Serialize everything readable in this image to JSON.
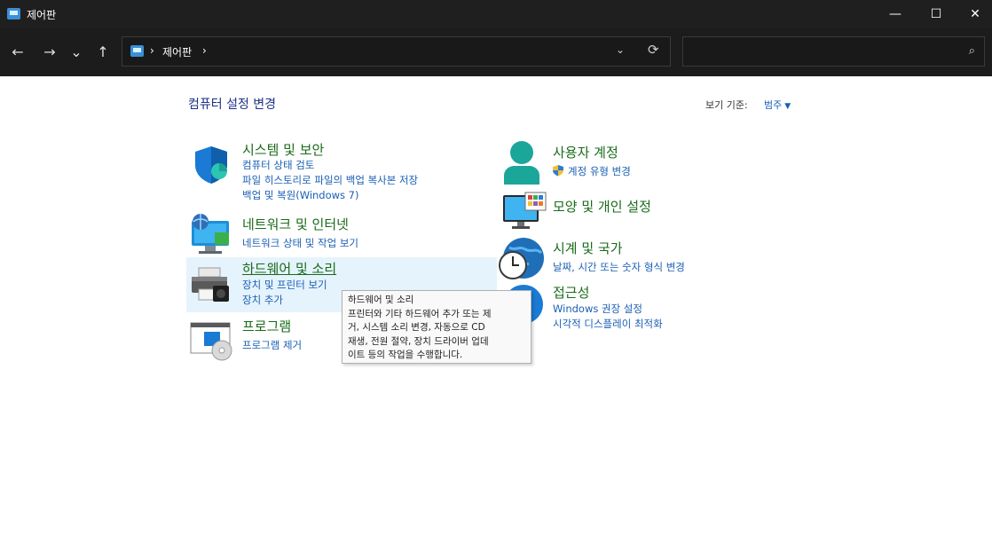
{
  "window": {
    "title": "제어판"
  },
  "titlebar": {
    "minimize": "—",
    "maximize": "☐",
    "close": "✕"
  },
  "nav": {
    "back": "←",
    "forward": "→",
    "recent": "⌄",
    "up": "↑"
  },
  "address": {
    "breadcrumb_sep1": "›",
    "location": "제어판",
    "breadcrumb_sep2": "›",
    "dropdown": "⌄",
    "refresh": "⟳"
  },
  "search": {
    "value": "",
    "icon": "⌕"
  },
  "content": {
    "heading": "컴퓨터 설정 변경",
    "view_by_label": "보기 기준:",
    "view_by_value": "범주",
    "view_by_caret": "▼"
  },
  "left_categories": [
    {
      "title": "시스템 및 보안",
      "icon": "shield-icon",
      "links": [
        "컴퓨터 상태 검토",
        "파일 히스토리로 파일의 백업 복사본 저장",
        "백업 및 복원(Windows 7)"
      ]
    },
    {
      "title": "네트워크 및 인터넷",
      "icon": "network-icon",
      "links": [
        "네트워크 상태 및 작업 보기"
      ]
    },
    {
      "title": "하드웨어 및 소리",
      "icon": "printer-icon",
      "links": [
        "장치 및 프린터 보기",
        "장치 추가"
      ]
    },
    {
      "title": "프로그램",
      "icon": "programs-icon",
      "links": [
        "프로그램 제거"
      ]
    }
  ],
  "right_categories": [
    {
      "title": "사용자 계정",
      "icon": "user-icon",
      "links": [
        "계정 유형 변경"
      ]
    },
    {
      "title": "모양 및 개인 설정",
      "icon": "monitor-icon",
      "links": []
    },
    {
      "title": "시계 및 국가",
      "icon": "clock-globe-icon",
      "links": [
        "날짜, 시간 또는 숫자 형식 변경"
      ]
    },
    {
      "title": "접근성",
      "icon": "accessibility-icon",
      "links": [
        "Windows 권장 설정",
        "시각적 디스플레이 최적화"
      ]
    }
  ],
  "tooltip": {
    "lines": [
      "하드웨어 및 소리",
      "프린터와 기타 하드웨어 추가 또는 제",
      "거, 시스템 소리 변경, 자동으로 CD",
      "재생, 전원 절약, 장치 드라이버 업데",
      "이트 등의 작업을 수행합니다."
    ]
  },
  "colors": {
    "title_bar": "#1f1f1f",
    "category_title": "#1a6b1a",
    "link": "#1a5fb4",
    "heading": "#1e3287",
    "hover_bg": "#e5f3fc"
  }
}
